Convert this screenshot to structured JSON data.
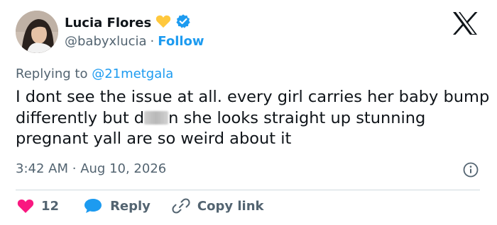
{
  "author": {
    "name": "Lucia Flores",
    "handle": "@babyxlucia",
    "separator": "·",
    "follow_label": "Follow"
  },
  "reply_context": {
    "prefix": "Replying to",
    "mention": "@21metgala"
  },
  "tweet": {
    "text_part1": "I dont see the issue at all. every girl carries her baby bump differently but d",
    "text_part2": "n she looks straight up stunning pregnant yall are so weird about it"
  },
  "meta": {
    "time": "3:42 AM",
    "separator": "·",
    "date": "Aug 10, 2026"
  },
  "actions": {
    "like_count": "12",
    "reply_label": "Reply",
    "copy_link_label": "Copy link"
  },
  "colors": {
    "accent": "#1d9bf0",
    "like": "#f91880",
    "muted": "#536471",
    "heart_emoji": "#ffc83d"
  },
  "icons": [
    "x-logo-icon",
    "yellow-heart-icon",
    "verified-badge-icon",
    "info-icon",
    "heart-icon",
    "reply-bubble-icon",
    "link-icon"
  ]
}
